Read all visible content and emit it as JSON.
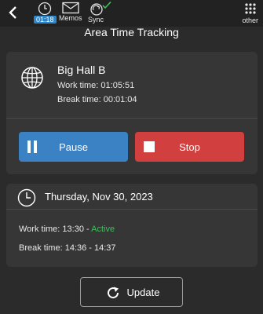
{
  "topbar": {
    "back_icon": "chevron-left-icon",
    "timer": {
      "icon": "clock-icon",
      "value": "01:18"
    },
    "memos": {
      "icon": "envelope-icon",
      "label": "Memos"
    },
    "sync": {
      "icon": "sync-check-icon",
      "label": "Sync"
    },
    "other": {
      "icon": "grid-icon",
      "label": "other"
    }
  },
  "page": {
    "title": "Area Time Tracking"
  },
  "location_card": {
    "icon": "globe-icon",
    "name": "Big Hall B",
    "work_time_label": "Work time:",
    "work_time_value": "01:05:51",
    "break_time_label": "Break time:",
    "break_time_value": "00:01:04",
    "pause_label": "Pause",
    "stop_label": "Stop"
  },
  "day_card": {
    "icon": "clock-icon",
    "date": "Thursday, Nov 30, 2023",
    "work_label": "Work time:",
    "work_value": "13:30 -",
    "work_status": "Active",
    "break_label": "Break time:",
    "break_value": "14:36 - 14:37"
  },
  "update": {
    "icon": "refresh-icon",
    "label": "Update"
  },
  "colors": {
    "background": "#2b2b2b",
    "card": "#363636",
    "pause": "#3b82c4",
    "stop": "#d23f3f",
    "active": "#3fbf5a",
    "badge": "#2e86c9"
  }
}
